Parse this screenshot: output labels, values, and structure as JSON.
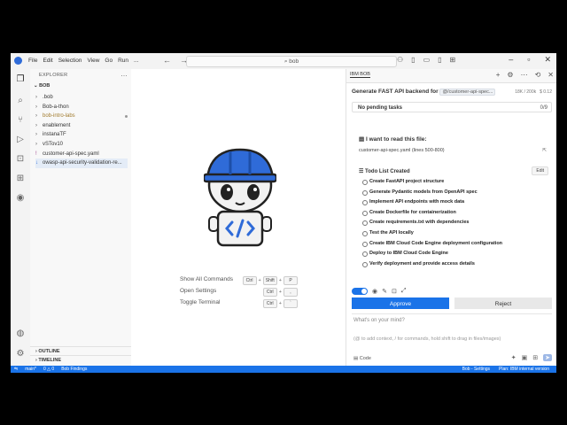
{
  "titlebar": {
    "menu": [
      "File",
      "Edit",
      "Selection",
      "View",
      "Go",
      "Run",
      "..."
    ],
    "search": "bob",
    "back_arrow": "←",
    "forward_arrow": "→"
  },
  "sidebar": {
    "title": "EXPLORER",
    "folder": "BOB",
    "items": [
      {
        "label": ".bob",
        "type": "folder"
      },
      {
        "label": "Bob-a-thon",
        "type": "folder"
      },
      {
        "label": "bob-intro-labs",
        "type": "folder",
        "modified": true
      },
      {
        "label": "enablement",
        "type": "folder"
      },
      {
        "label": "instanaTF",
        "type": "folder"
      },
      {
        "label": "vSTov10",
        "type": "folder"
      },
      {
        "label": "customer-api-spec.yaml",
        "type": "file"
      },
      {
        "label": "owasp-api-security-validation-re...",
        "type": "file"
      }
    ],
    "outline": "OUTLINE",
    "timeline": "TIMELINE"
  },
  "editor": {
    "shortcuts": [
      {
        "label": "Show All Commands",
        "keys": [
          "Ctrl",
          "+",
          "Shift",
          "+",
          "P"
        ]
      },
      {
        "label": "Open Settings",
        "keys": [
          "Ctrl",
          "+",
          ","
        ]
      },
      {
        "label": "Toggle Terminal",
        "keys": [
          "Ctrl",
          "+",
          "`"
        ]
      }
    ]
  },
  "panel": {
    "tab": "IBM BOB",
    "task_title": "Generate FAST API backend for",
    "task_ref": "@/customer-api-spec...",
    "task_tokens": "18K / 200k",
    "task_cost": "$ 0.12",
    "pending_label": "No pending tasks",
    "pending_count": "0/9",
    "read_label": "I want to read this file:",
    "read_path": "customer-api-spec.yaml",
    "read_lines": "(lines 500-800)",
    "todo_header": "Todo List Created",
    "todo_edit": "Edit",
    "todos": [
      "Create FastAPI project structure",
      "Generate Pydantic models from OpenAPI spec",
      "Implement API endpoints with mock data",
      "Create Dockerfile for containerization",
      "Create requirements.txt with dependencies",
      "Test the API locally",
      "Create IBM Cloud Code Engine deployment configuration",
      "Deploy to IBM Cloud Code Engine",
      "Verify deployment and provide access details"
    ],
    "approve": "Approve",
    "reject": "Reject",
    "chat_placeholder": "What's on your mind?",
    "chat_hint": "(@ to add context, / for commands, hold shift to drag in files/images)",
    "mode": "Code"
  },
  "statusbar": {
    "branch": "main*",
    "problems": "0 △ 0",
    "user": "Bob Findings",
    "settings": "Bob - Settings",
    "plan": "Plan: IBM internal version"
  },
  "colors": {
    "accent": "#1a73e8",
    "helmet": "#2f6bd8"
  }
}
